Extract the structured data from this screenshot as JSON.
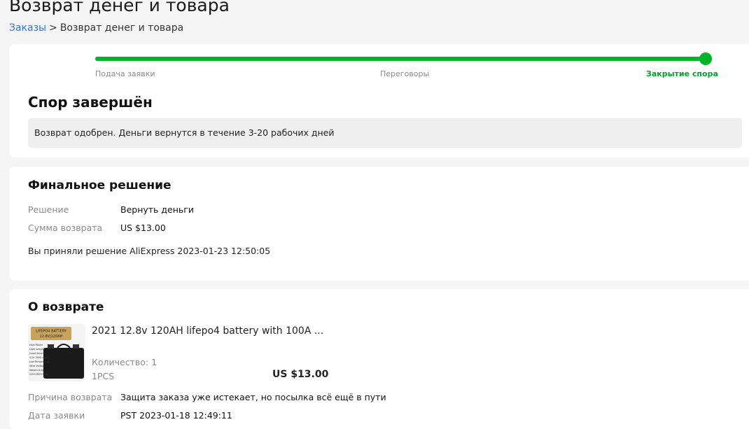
{
  "page": {
    "title": "Возврат денег и товара"
  },
  "breadcrumb": {
    "link": "Заказы",
    "separator": ">",
    "current": "Возврат денег и товара"
  },
  "progress": {
    "steps": [
      "Подача заявки",
      "Переговоры",
      "Закрытие спора"
    ],
    "active_step": 3,
    "accent": "#00b42a"
  },
  "status": {
    "title": "Спор завершён",
    "message": "Возврат одобрен. Деньги вернутся в течение 3-20 рабочих дней"
  },
  "decision": {
    "title": "Финальное решение",
    "rows": [
      {
        "label": "Решение",
        "value": "Вернуть деньги"
      },
      {
        "label": "Сумма возврата",
        "value": "US $13.00"
      }
    ],
    "note": "Вы приняли решение AliExpress 2023-01-23 12:50:05"
  },
  "return_info": {
    "title": "О возврате",
    "product": {
      "name": "2021 12.8v 120AH lifepo4 battery with 100A ...",
      "quantity": "Количество: 1",
      "unit": "1PCS",
      "price": "US $13.00",
      "thumb_label_1": "LIFEPO4 BATTERY",
      "thumb_label_2": "12.8V|120AH",
      "thumb_features": [
        "High Power",
        "Light weight",
        "Good Volume",
        "4-5k 3000 cycles",
        "Low Temperature",
        "Wide Voltage",
        "Weight 6 kg",
        "220*130*195mm"
      ]
    },
    "rows": [
      {
        "label": "Причина возврата",
        "value": "Защита заказа уже истекает, но посылка всё ещё в пути"
      },
      {
        "label": "Дата заявки",
        "value": "PST 2023-01-18 12:49:11"
      }
    ]
  }
}
